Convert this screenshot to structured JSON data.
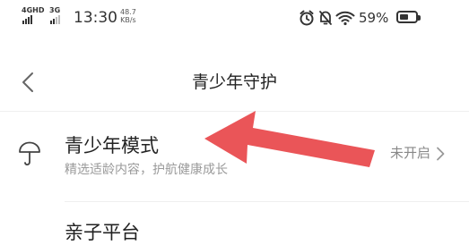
{
  "status_bar": {
    "net1": "4GHD",
    "net2": "3G",
    "time": "13:30",
    "speed_value": "48.7",
    "speed_unit": "KB/s",
    "battery_pct": "59%",
    "battery_level": 0.59,
    "icons": [
      "alarm-icon",
      "mute-icon",
      "wifi-icon",
      "battery-icon"
    ]
  },
  "nav": {
    "title": "青少年守护",
    "back_icon": "back-chevron-icon"
  },
  "list": [
    {
      "title": "青少年模式",
      "subtitle": "精选适龄内容，护航健康成长",
      "status": "未开启",
      "icon": "umbrella-icon"
    },
    {
      "title": "亲子平台"
    }
  ],
  "annotation": {
    "type": "arrow",
    "color": "#e8474a"
  },
  "colors": {
    "background": "#ffffff",
    "text": "#222222",
    "subtext": "#9a9a9a"
  }
}
